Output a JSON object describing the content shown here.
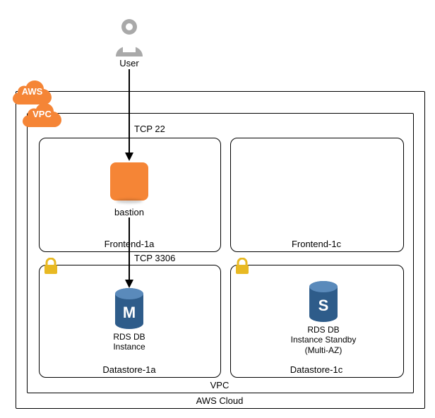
{
  "user_label": "User",
  "aws_badge": "AWS",
  "vpc_badge": "VPC",
  "aws_cloud_label": "AWS Cloud",
  "vpc_label": "VPC",
  "conn_top": "TCP 22",
  "conn_mid": "TCP 3306",
  "subnets": {
    "frontend_1a": "Frontend-1a",
    "frontend_1c": "Frontend-1c",
    "datastore_1a": "Datastore-1a",
    "datastore_1c": "Datastore-1c"
  },
  "bastion_label": "bastion",
  "rds_primary": {
    "letter": "M",
    "label": "RDS DB\nInstance"
  },
  "rds_standby": {
    "letter": "S",
    "label": "RDS DB\nInstance Standby\n(Multi-AZ)"
  }
}
